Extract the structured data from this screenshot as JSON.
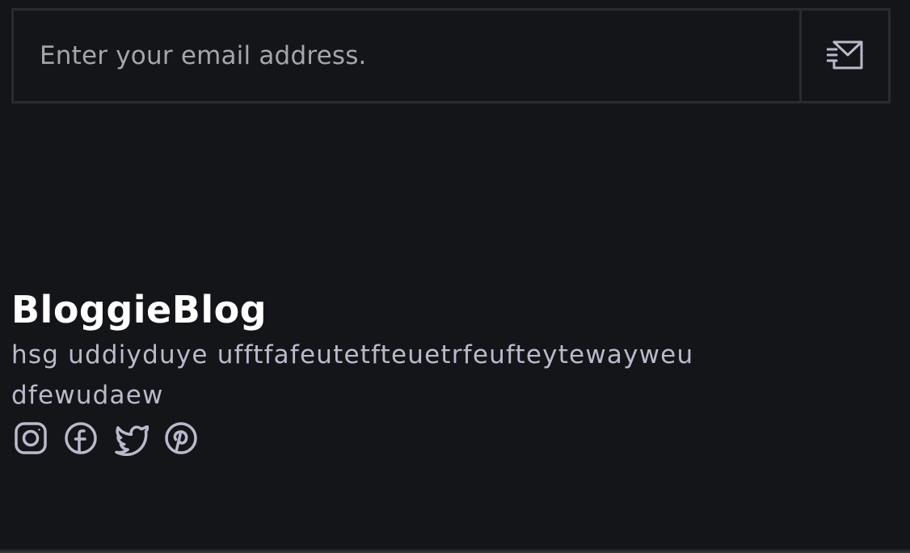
{
  "newsletter": {
    "email_placeholder": "Enter your email address.",
    "email_value": "",
    "send_icon": "send-mail-icon"
  },
  "footer": {
    "brand_name": "BloggieBlog",
    "description": "hsg uddiyduye ufftfafeutetfteuetrfeufteytewayweudfewudaew",
    "social_links": [
      {
        "name": "Instagram",
        "icon": "instagram-icon"
      },
      {
        "name": "Facebook",
        "icon": "facebook-icon"
      },
      {
        "name": "Twitter",
        "icon": "twitter-icon"
      },
      {
        "name": "Pinterest",
        "icon": "pinterest-icon"
      }
    ]
  },
  "colors": {
    "background": "#141519",
    "border": "#2a2b30",
    "brand_text": "#ffffff",
    "muted_text": "#b9bbcc",
    "icon": "#b9bbcc"
  }
}
